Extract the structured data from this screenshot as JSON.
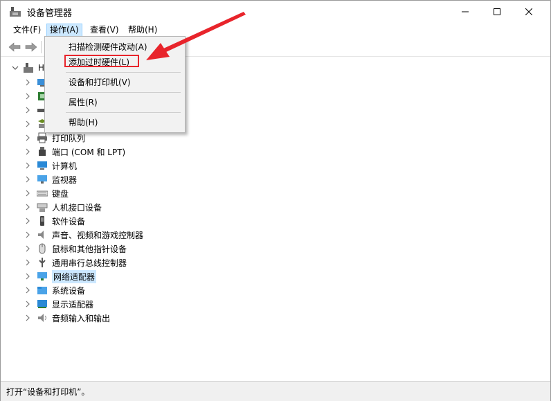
{
  "window": {
    "title": "设备管理器",
    "controls": {
      "minimize": "minimize",
      "maximize": "maximize",
      "close": "close"
    }
  },
  "menubar": {
    "items": [
      "文件(F)",
      "操作(A)",
      "查看(V)",
      "帮助(H)"
    ],
    "active": "操作(A)"
  },
  "dropdown": {
    "items": [
      "扫描检测硬件改动(A)",
      "添加过时硬件(L)",
      "设备和打印机(V)",
      "属性(R)",
      "帮助(H)"
    ],
    "highlighted_item": "添加过时硬件(L)"
  },
  "tree": {
    "root_label": "HI",
    "items": [
      {
        "label": "打印队列",
        "icon": "printer-icon"
      },
      {
        "label": "端口 (COM 和 LPT)",
        "icon": "port-icon"
      },
      {
        "label": "计算机",
        "icon": "computer-icon"
      },
      {
        "label": "监视器",
        "icon": "monitor-icon"
      },
      {
        "label": "键盘",
        "icon": "keyboard-icon"
      },
      {
        "label": "人机接口设备",
        "icon": "hid-icon"
      },
      {
        "label": "软件设备",
        "icon": "software-device-icon"
      },
      {
        "label": "声音、视频和游戏控制器",
        "icon": "speaker-icon"
      },
      {
        "label": "鼠标和其他指针设备",
        "icon": "mouse-icon"
      },
      {
        "label": "通用串行总线控制器",
        "icon": "usb-icon"
      },
      {
        "label": "网络适配器",
        "icon": "network-icon"
      },
      {
        "label": "系统设备",
        "icon": "system-folder-icon"
      },
      {
        "label": "显示适配器",
        "icon": "display-adapter-icon"
      },
      {
        "label": "音频输入和输出",
        "icon": "audio-io-icon"
      }
    ],
    "selected": "网络适配器"
  },
  "statusbar": {
    "text": "打开“设备和打印机”。"
  },
  "colors": {
    "annotation": "#e8242b",
    "selection": "#cce8ff",
    "menu_bg": "#f2f2f2"
  }
}
